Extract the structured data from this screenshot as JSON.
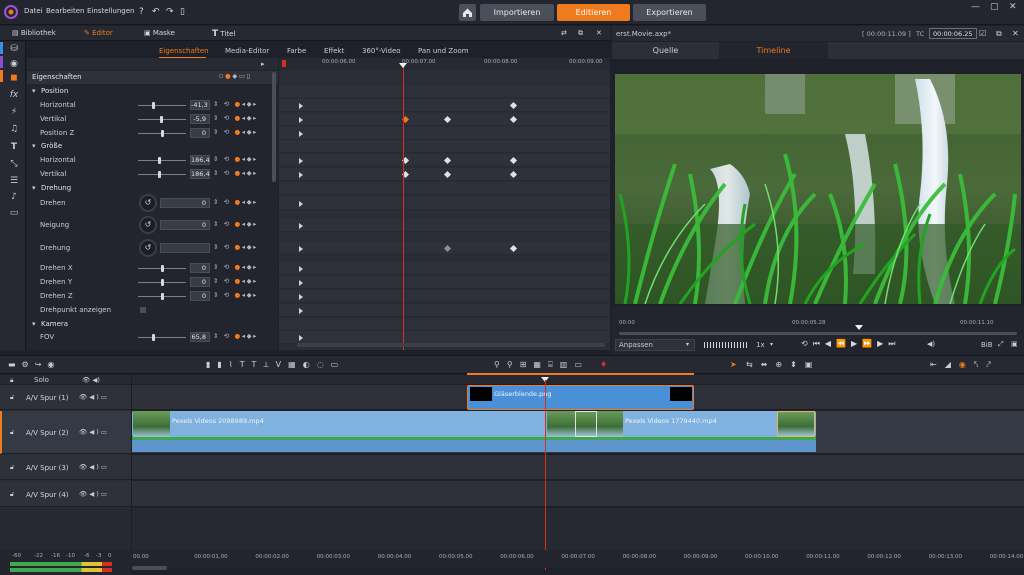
{
  "menu": {
    "items": [
      "Datei",
      "Bearbeiten",
      "Einstellungen"
    ]
  },
  "modes": [
    {
      "label": "Importieren",
      "active": false
    },
    {
      "label": "Editieren",
      "active": true
    },
    {
      "label": "Exportieren",
      "active": false
    }
  ],
  "library_tabs": [
    {
      "label": "Bibliothek",
      "active": false
    },
    {
      "label": "Editor",
      "active": true
    },
    {
      "label": "Maske",
      "active": false
    },
    {
      "label": "Titel",
      "active": false
    }
  ],
  "editor_tabs": [
    {
      "label": "Eigenschaften",
      "active": true
    },
    {
      "label": "Media-Editor",
      "active": false
    },
    {
      "label": "Farbe",
      "active": false
    },
    {
      "label": "Effekt",
      "active": false
    },
    {
      "label": "360°-Video",
      "active": false
    },
    {
      "label": "Pan und Zoom",
      "active": false
    }
  ],
  "properties": {
    "header": "Eigenschaften",
    "rows": [
      {
        "label": "Position",
        "type": "section"
      },
      {
        "label": "Horizontal",
        "value": "-41,3",
        "slider": 0.3
      },
      {
        "label": "Vertikal",
        "value": "-5,9",
        "slider": 0.48
      },
      {
        "label": "Position Z",
        "value": "0",
        "slider": 0.5
      },
      {
        "label": "Größe",
        "type": "section"
      },
      {
        "label": "Horizontal",
        "value": "186,4",
        "slider": 0.45
      },
      {
        "label": "Vertikal",
        "value": "186,4",
        "slider": 0.45
      },
      {
        "label": "Drehung",
        "type": "section"
      },
      {
        "label": "Drehen",
        "value": "0",
        "dial": true
      },
      {
        "label": "Neigung",
        "value": "0",
        "dial": true
      },
      {
        "label": "Drehung",
        "value": "",
        "dial": true
      },
      {
        "label": "Drehen X",
        "value": "0",
        "slider": 0.5
      },
      {
        "label": "Drehen Y",
        "value": "0",
        "slider": 0.5
      },
      {
        "label": "Drehen Z",
        "value": "0",
        "slider": 0.5
      },
      {
        "label": "Drehpunkt anzeigen",
        "type": "checkbox"
      },
      {
        "label": "Kamera",
        "type": "section"
      },
      {
        "label": "FOV",
        "value": "65,8",
        "slider": 0.3
      }
    ]
  },
  "kf_ruler": [
    "00:00:06.00",
    "00:00:07.00",
    "00:00:08.00",
    "00:00:09.00"
  ],
  "preview": {
    "project_name": "erst.Movie.axp*",
    "timecode_total": "00:00:11.09",
    "tc_label": "TC",
    "timecode_current": "00:00:06.25",
    "tabs": [
      {
        "label": "Quelle",
        "active": false
      },
      {
        "label": "Timeline",
        "active": true
      }
    ],
    "scrub_labels": [
      "00:00",
      "00:00:05.28",
      "00:00:11.10"
    ],
    "fit_label": "Anpassen",
    "speed_label": "1x",
    "bib_label": "BiB"
  },
  "tracks": [
    {
      "name": "Solo"
    },
    {
      "name": "A/V Spur (1)"
    },
    {
      "name": "A/V Spur (2)"
    },
    {
      "name": "A/V Spur (3)"
    },
    {
      "name": "A/V Spur (4)"
    }
  ],
  "clips": {
    "overlay": "Gläserblende.png",
    "video1": "Pexels Videos 2098989.mp4",
    "video2": "Pexels Videos 1779440.mp4"
  },
  "meter_labels": [
    "-60",
    "-22",
    "-16",
    "-10",
    "-6",
    "-3",
    "0"
  ],
  "timeline_ruler": [
    "00.00",
    "00:00:01.00",
    "00:00:02.00",
    "00:00:03.00",
    "00:00:04.00",
    "00:00:05.00",
    "00:00:06.00",
    "00:00:07.00",
    "00:00:08.00",
    "00:00:09.00",
    "00:00:10.00",
    "00:00:11.00",
    "00:00:12.00",
    "00:00:13.00",
    "00:00:14.00"
  ],
  "colors": {
    "accent": "#f07a1e",
    "clip_blue": "#7fb2df",
    "playhead": "#d5301f"
  }
}
